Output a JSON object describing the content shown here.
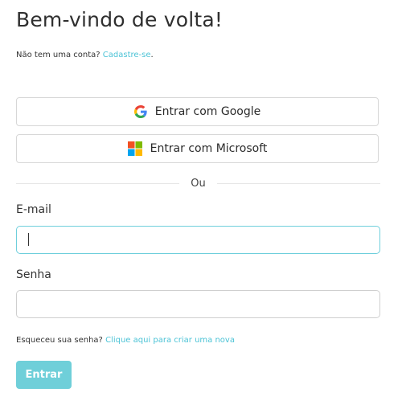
{
  "page": {
    "title": "Bem-vindo de volta!",
    "signup_prompt": "Não tem uma conta?",
    "signup_link": "Cadastre-se",
    "signup_suffix": "."
  },
  "sso": {
    "google_label": "Entrar com Google",
    "microsoft_label": "Entrar com Microsoft"
  },
  "divider_text": "Ou",
  "form": {
    "email_label": "E-mail",
    "email_value": "",
    "password_label": "Senha",
    "password_value": "",
    "forgot_prompt": "Esqueceu sua senha?",
    "forgot_link": "Clique aqui para criar uma nova",
    "submit_label": "Entrar"
  },
  "colors": {
    "accent": "#4cc3d6",
    "button": "#6fcfd9"
  },
  "icons": {
    "google": "google-logo-icon",
    "microsoft": "microsoft-logo-icon"
  }
}
